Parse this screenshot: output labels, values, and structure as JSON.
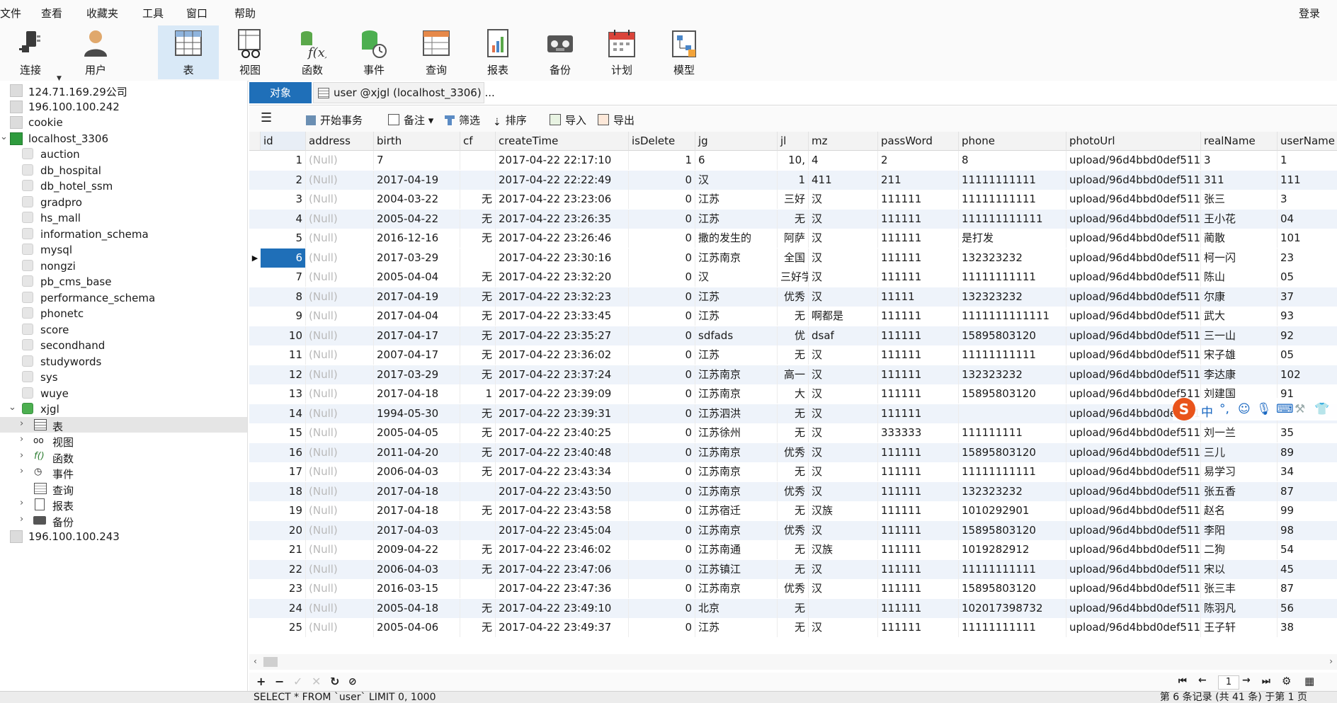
{
  "menu": [
    "文件",
    "查看",
    "收藏夹",
    "工具",
    "窗口",
    "帮助"
  ],
  "login_label": "登录",
  "toolbar": [
    {
      "label": "连接",
      "icon": "plug-icon"
    },
    {
      "label": "用户",
      "icon": "user-icon"
    },
    {
      "label": "表",
      "icon": "table-icon",
      "active": true
    },
    {
      "label": "视图",
      "icon": "view-icon"
    },
    {
      "label": "函数",
      "icon": "function-icon"
    },
    {
      "label": "事件",
      "icon": "event-icon"
    },
    {
      "label": "查询",
      "icon": "query-icon"
    },
    {
      "label": "报表",
      "icon": "report-icon"
    },
    {
      "label": "备份",
      "icon": "backup-icon"
    },
    {
      "label": "计划",
      "icon": "calendar-icon"
    },
    {
      "label": "模型",
      "icon": "model-icon"
    }
  ],
  "navigator": {
    "connections_top": [
      "124.71.169.29公司",
      "196.100.100.242",
      "cookie"
    ],
    "open_connection": "localhost_3306",
    "databases": [
      "auction",
      "db_hospital",
      "db_hotel_ssm",
      "gradpro",
      "hs_mall",
      "information_schema",
      "mysql",
      "nongzi",
      "pb_cms_base",
      "performance_schema",
      "phonetc",
      "score",
      "secondhand",
      "studywords",
      "sys",
      "wuye"
    ],
    "open_database": "xjgl",
    "object_groups": [
      "表",
      "视图",
      "函数",
      "事件",
      "查询",
      "报表",
      "备份"
    ],
    "connections_bottom": [
      "196.100.100.243"
    ]
  },
  "tabs": {
    "objects": "对象",
    "active": "user @xjgl (localhost_3306) ..."
  },
  "grid_toolbar": {
    "begin_transaction": "开始事务",
    "memo": "备注",
    "filter": "筛选",
    "sort": "排序",
    "import": "导入",
    "export": "导出"
  },
  "columns": [
    "id",
    "address",
    "birth",
    "cf",
    "createTime",
    "isDelete",
    "jg",
    "jl",
    "mz",
    "passWord",
    "phone",
    "photoUrl",
    "realName",
    "userName"
  ],
  "rows": [
    [
      "1",
      "(Null)",
      "7",
      "",
      "2017-04-22 22:17:10",
      "1",
      "6",
      "10,",
      "4",
      "2",
      "8",
      "upload/96d4bbd0def511",
      "3",
      "1"
    ],
    [
      "2",
      "(Null)",
      "2017-04-19",
      "",
      "2017-04-22 22:22:49",
      "0",
      "汉",
      "1",
      "411",
      "211",
      "11111111111",
      "upload/96d4bbd0def511",
      "311",
      "111"
    ],
    [
      "3",
      "(Null)",
      "2004-03-22",
      "无",
      "2017-04-22 23:23:06",
      "0",
      "江苏",
      "三好",
      "汉",
      "111111",
      "11111111111",
      "upload/96d4bbd0def511",
      "张三",
      "3"
    ],
    [
      "4",
      "(Null)",
      "2005-04-22",
      "无",
      "2017-04-22 23:26:35",
      "0",
      "江苏",
      "无",
      "汉",
      "111111",
      "111111111111",
      "upload/96d4bbd0def511",
      "王小花",
      "04"
    ],
    [
      "5",
      "(Null)",
      "2016-12-16",
      "无",
      "2017-04-22 23:26:46",
      "0",
      "撒的发生的",
      "阿萨",
      "汉",
      "111111",
      "是打发",
      "upload/96d4bbd0def511",
      "蔺散",
      "101"
    ],
    [
      "6",
      "(Null)",
      "2017-03-29",
      "",
      "2017-04-22 23:30:16",
      "0",
      "江苏南京",
      "全国",
      "汉",
      "111111",
      "132323232",
      "upload/96d4bbd0def511",
      "柯一闪",
      "23"
    ],
    [
      "7",
      "(Null)",
      "2005-04-04",
      "无",
      "2017-04-22 23:32:20",
      "0",
      "汉",
      "三好学",
      "汉",
      "111111",
      "11111111111",
      "upload/96d4bbd0def511",
      "陈山",
      "05"
    ],
    [
      "8",
      "(Null)",
      "2017-04-19",
      "无",
      "2017-04-22 23:32:23",
      "0",
      "江苏",
      "优秀",
      "汉",
      "11111",
      "132323232",
      "upload/96d4bbd0def511",
      "尔康",
      "37"
    ],
    [
      "9",
      "(Null)",
      "2017-04-04",
      "无",
      "2017-04-22 23:33:45",
      "0",
      "江苏",
      "无",
      "啊都是",
      "111111",
      "1111111111111",
      "upload/96d4bbd0def511",
      "武大",
      "93"
    ],
    [
      "10",
      "(Null)",
      "2017-04-17",
      "无",
      "2017-04-22 23:35:27",
      "0",
      "sdfads",
      "优",
      "dsaf",
      "111111",
      "15895803120",
      "upload/96d4bbd0def511",
      "三一山",
      "92"
    ],
    [
      "11",
      "(Null)",
      "2007-04-17",
      "无",
      "2017-04-22 23:36:02",
      "0",
      "江苏",
      "无",
      "汉",
      "111111",
      "11111111111",
      "upload/96d4bbd0def511",
      "宋子雄",
      "05"
    ],
    [
      "12",
      "(Null)",
      "2017-03-29",
      "无",
      "2017-04-22 23:37:24",
      "0",
      "江苏南京",
      "高一",
      "汉",
      "111111",
      "132323232",
      "upload/96d4bbd0def511",
      "李达康",
      "102"
    ],
    [
      "13",
      "(Null)",
      "2017-04-18",
      "1",
      "2017-04-22 23:39:09",
      "0",
      "江苏南京",
      "大",
      "汉",
      "111111",
      "15895803120",
      "upload/96d4bbd0def511",
      "刘建国",
      "91"
    ],
    [
      "14",
      "(Null)",
      "1994-05-30",
      "无",
      "2017-04-22 23:39:31",
      "0",
      "江苏泗洪",
      "无",
      "汉",
      "111111",
      "",
      "upload/96d4bbd0def511",
      "",
      ""
    ],
    [
      "15",
      "(Null)",
      "2005-04-05",
      "无",
      "2017-04-22 23:40:25",
      "0",
      "江苏徐州",
      "无",
      "汉",
      "333333",
      "111111111",
      "upload/96d4bbd0def511",
      "刘一兰",
      "35"
    ],
    [
      "16",
      "(Null)",
      "2011-04-20",
      "无",
      "2017-04-22 23:40:48",
      "0",
      "江苏南京",
      "优秀",
      "汉",
      "111111",
      "15895803120",
      "upload/96d4bbd0def511",
      "三儿",
      "89"
    ],
    [
      "17",
      "(Null)",
      "2006-04-03",
      "无",
      "2017-04-22 23:43:34",
      "0",
      "江苏南京",
      "无",
      "汉",
      "111111",
      "11111111111",
      "upload/96d4bbd0def511",
      "易学习",
      "34"
    ],
    [
      "18",
      "(Null)",
      "2017-04-18",
      "",
      "2017-04-22 23:43:50",
      "0",
      "江苏南京",
      "优秀",
      "汉",
      "111111",
      "132323232",
      "upload/96d4bbd0def511",
      "张五香",
      "87"
    ],
    [
      "19",
      "(Null)",
      "2017-04-18",
      "无",
      "2017-04-22 23:43:58",
      "0",
      "江苏宿迁",
      "无",
      "汉族",
      "111111",
      "1010292901",
      "upload/96d4bbd0def511",
      "赵名",
      "99"
    ],
    [
      "20",
      "(Null)",
      "2017-04-03",
      "",
      "2017-04-22 23:45:04",
      "0",
      "江苏南京",
      "优秀",
      "汉",
      "111111",
      "15895803120",
      "upload/96d4bbd0def511",
      "李阳",
      "98"
    ],
    [
      "21",
      "(Null)",
      "2009-04-22",
      "无",
      "2017-04-22 23:46:02",
      "0",
      "江苏南通",
      "无",
      "汉族",
      "111111",
      "1019282912",
      "upload/96d4bbd0def511",
      "二狗",
      "54"
    ],
    [
      "22",
      "(Null)",
      "2006-04-03",
      "无",
      "2017-04-22 23:47:06",
      "0",
      "江苏镇江",
      "无",
      "汉",
      "111111",
      "11111111111",
      "upload/96d4bbd0def511",
      "宋以",
      "45"
    ],
    [
      "23",
      "(Null)",
      "2016-03-15",
      "",
      "2017-04-22 23:47:36",
      "0",
      "江苏南京",
      "优秀",
      "汉",
      "111111",
      "15895803120",
      "upload/96d4bbd0def511",
      "张三丰",
      "87"
    ],
    [
      "24",
      "(Null)",
      "2005-04-18",
      "无",
      "2017-04-22 23:49:10",
      "0",
      "北京",
      "无",
      "",
      "111111",
      "102017398732",
      "upload/96d4bbd0def511",
      "陈羽凡",
      "56"
    ],
    [
      "25",
      "(Null)",
      "2005-04-06",
      "无",
      "2017-04-22 23:49:37",
      "0",
      "江苏",
      "无",
      "汉",
      "111111",
      "11111111111",
      "upload/96d4bbd0def511",
      "王子轩",
      "38"
    ]
  ],
  "selected_row_id": "6",
  "page_number": "1",
  "status": {
    "sql": "SELECT * FROM `user` LIMIT 0, 1000",
    "records": "第 6 条记录 (共 41 条) 于第 1 页"
  },
  "ime": {
    "logo": "S",
    "mode": "中"
  },
  "colors": {
    "accent": "#1f6fb8",
    "row_selected": "#1f6fb8",
    "null_text": "#b9b9b9",
    "tool_active": "#d9e9f7"
  }
}
